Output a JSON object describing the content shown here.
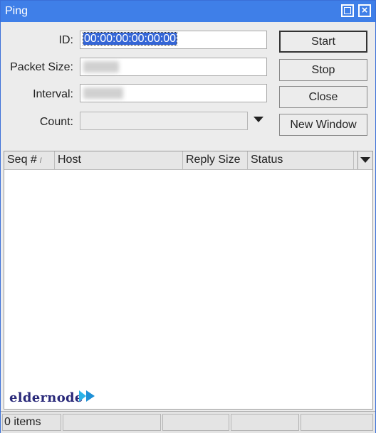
{
  "window": {
    "title": "Ping"
  },
  "form": {
    "id_label": "ID:",
    "id_value": "00:00:00:00:00:00",
    "packet_size_label": "Packet Size:",
    "interval_label": "Interval:",
    "count_label": "Count:"
  },
  "buttons": {
    "start": "Start",
    "stop": "Stop",
    "close": "Close",
    "new_window": "New Window"
  },
  "table": {
    "columns": [
      "Seq #",
      "Host",
      "Reply Size",
      "Status"
    ],
    "sort_indicator": "/",
    "rows": []
  },
  "watermark": {
    "text": "eldernode"
  },
  "status": {
    "items": "0 items"
  },
  "icons": {
    "maximize": "maximize-icon",
    "close": "close-icon",
    "dropdown": "chevron-down-icon",
    "column_menu": "chevron-down-icon"
  },
  "colors": {
    "titlebar": "#3f7fe8",
    "selection": "#3465d6",
    "window_bg": "#ececec"
  }
}
